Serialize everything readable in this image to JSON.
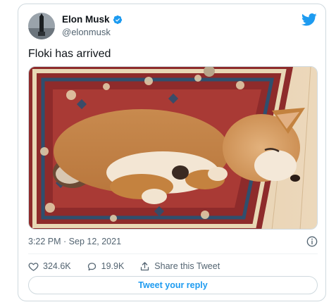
{
  "author": {
    "name": "Elon Musk",
    "handle": "@elonmusk",
    "verified_color": "#1d9bf0"
  },
  "tweet": {
    "text": "Floki has arrived",
    "timestamp": "3:22 PM · Sep 12, 2021",
    "image_icon": "shiba-inu-puppy-sleeping-on-rug-photo"
  },
  "actions": {
    "likes": "324.6K",
    "replies": "19.9K",
    "share_label": "Share this Tweet"
  },
  "reply_button": {
    "label": "Tweet your reply"
  },
  "colors": {
    "brand": "#1d9bf0",
    "text": "#0f1419",
    "secondary": "#536471"
  }
}
